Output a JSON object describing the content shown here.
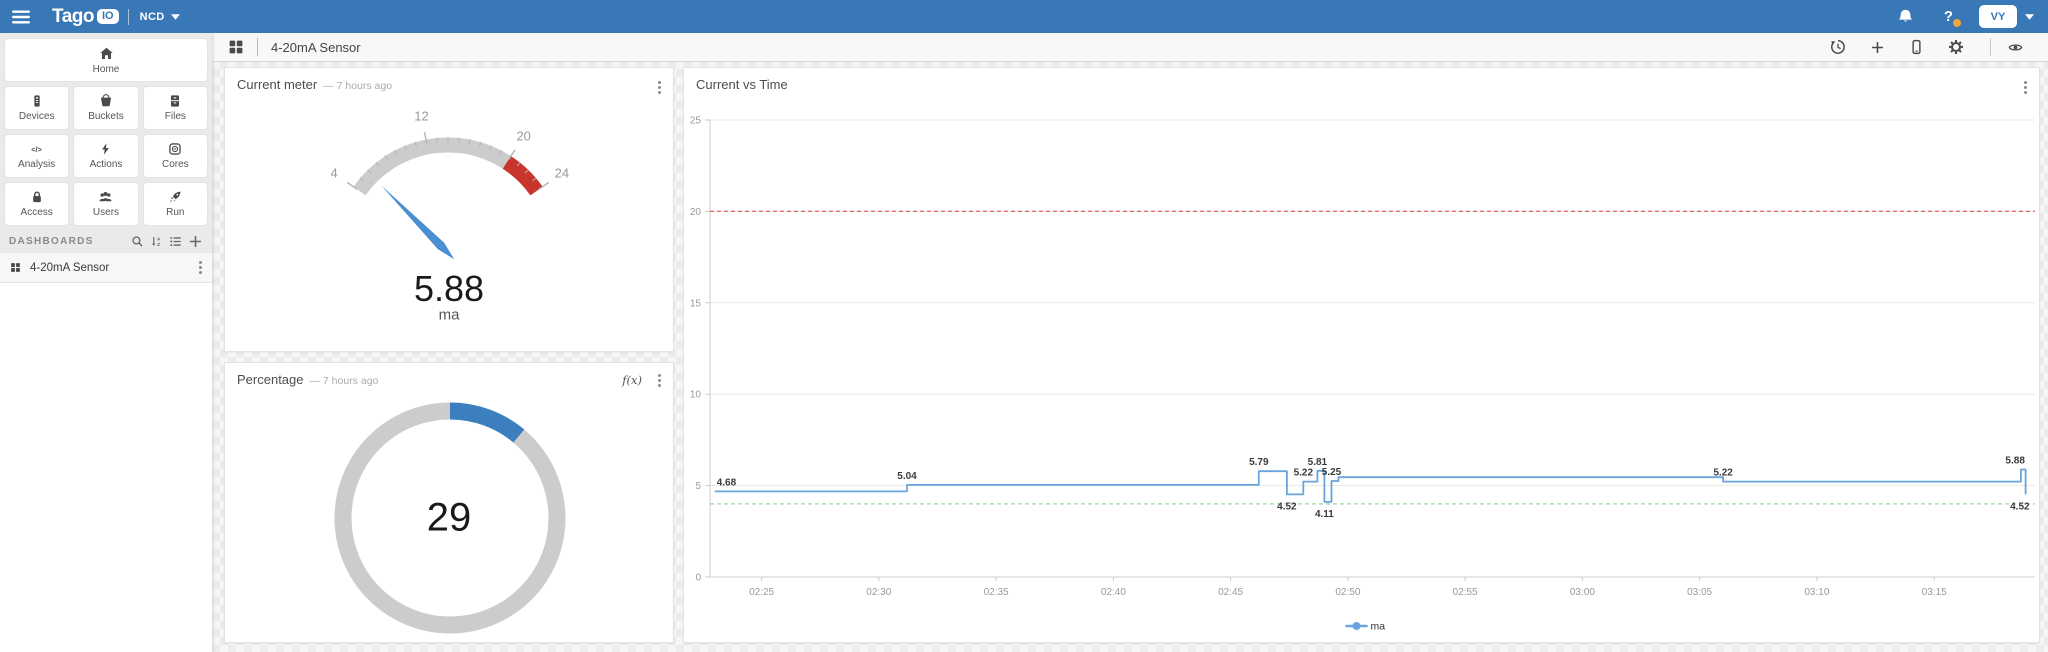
{
  "navbar": {
    "brand": "Tago",
    "brand_badge": "IO",
    "workspace": "NCD",
    "help_glyph": "?",
    "avatar_initials": "VY"
  },
  "toolbar": {
    "dashboard_title": "4-20mA Sensor"
  },
  "sidebar": {
    "home_label": "Home",
    "tiles": [
      {
        "label": "Devices",
        "icon": "devices-icon"
      },
      {
        "label": "Buckets",
        "icon": "buckets-icon"
      },
      {
        "label": "Files",
        "icon": "files-icon"
      },
      {
        "label": "Analysis",
        "icon": "analysis-icon"
      },
      {
        "label": "Actions",
        "icon": "actions-icon"
      },
      {
        "label": "Cores",
        "icon": "cores-icon"
      },
      {
        "label": "Access",
        "icon": "access-icon"
      },
      {
        "label": "Users",
        "icon": "users-icon"
      },
      {
        "label": "Run",
        "icon": "run-icon"
      }
    ],
    "dashboards_heading": "DASHBOARDS",
    "dashboard_items": [
      {
        "label": "4-20mA Sensor"
      }
    ]
  },
  "widgets": {
    "meter": {
      "title": "Current meter",
      "timestamp": "— 7 hours ago",
      "value": "5.88",
      "unit": "ma",
      "gauge": {
        "min": 4,
        "max": 24,
        "value": 5.88,
        "tick_labels": [
          4,
          12,
          20,
          24
        ],
        "danger_from": 20,
        "danger_to": 24,
        "colors": {
          "track": "#cccccc",
          "danger": "#c8352c",
          "needle": "#4b8fd3"
        }
      }
    },
    "percentage": {
      "title": "Percentage",
      "timestamp": "— 7 hours ago",
      "value": "29",
      "formula_label": "f(x)",
      "donut": {
        "sweep_deg": 40,
        "colors": {
          "track": "#cccccc",
          "progress": "#3c7fbe"
        }
      }
    }
  },
  "chart_data": {
    "type": "line",
    "title": "Current vs Time",
    "step": "after",
    "ylabel": "ma",
    "ylim": [
      0,
      25
    ],
    "yticks": [
      0,
      5,
      10,
      15,
      20,
      25
    ],
    "x_range": [
      142.8,
      199.3
    ],
    "xticks": [
      {
        "t": 145,
        "label": "02:25"
      },
      {
        "t": 150,
        "label": "02:30"
      },
      {
        "t": 155,
        "label": "02:35"
      },
      {
        "t": 160,
        "label": "02:40"
      },
      {
        "t": 165,
        "label": "02:45"
      },
      {
        "t": 170,
        "label": "02:50"
      },
      {
        "t": 175,
        "label": "02:55"
      },
      {
        "t": 180,
        "label": "03:00"
      },
      {
        "t": 185,
        "label": "03:05"
      },
      {
        "t": 190,
        "label": "03:10"
      },
      {
        "t": 195,
        "label": "03:15"
      }
    ],
    "series": [
      {
        "name": "ma",
        "color": "#69a5dc",
        "points": [
          {
            "t": 143.0,
            "v": 4.68,
            "label": "4.68",
            "label_pos": "top",
            "anchor": "start"
          },
          {
            "t": 151.2,
            "v": 5.04,
            "label": "5.04",
            "label_pos": "top"
          },
          {
            "t": 166.2,
            "v": 5.79,
            "label": "5.79",
            "label_pos": "top"
          },
          {
            "t": 167.4,
            "v": 4.52,
            "label": "4.52",
            "label_pos": "bottom"
          },
          {
            "t": 168.1,
            "v": 5.22,
            "label": "5.22",
            "label_pos": "top"
          },
          {
            "t": 168.7,
            "v": 5.81,
            "label": "5.81",
            "label_pos": "top"
          },
          {
            "t": 169.0,
            "v": 4.11,
            "label": "4.11",
            "label_pos": "bottom"
          },
          {
            "t": 169.3,
            "v": 5.25,
            "label": "5.25",
            "label_pos": "top"
          },
          {
            "t": 169.6,
            "v": 5.46,
            "label": "",
            "label_pos": "top"
          },
          {
            "t": 186.0,
            "v": 5.22,
            "label": "5.22",
            "label_pos": "top"
          },
          {
            "t": 198.7,
            "v": 5.88,
            "label": "5.88",
            "label_pos": "top",
            "anchor": "end"
          },
          {
            "t": 198.9,
            "v": 4.52,
            "label": "4.52",
            "label_pos": "bottom",
            "anchor": "end"
          }
        ]
      }
    ],
    "thresholds": [
      {
        "value": 20,
        "color": "#e0645c"
      },
      {
        "value": 4,
        "color": "#9fd8a0"
      }
    ],
    "legend": [
      {
        "name": "ma",
        "color": "#69a5dc"
      }
    ],
    "legend_position": "bottom",
    "grid": true
  }
}
